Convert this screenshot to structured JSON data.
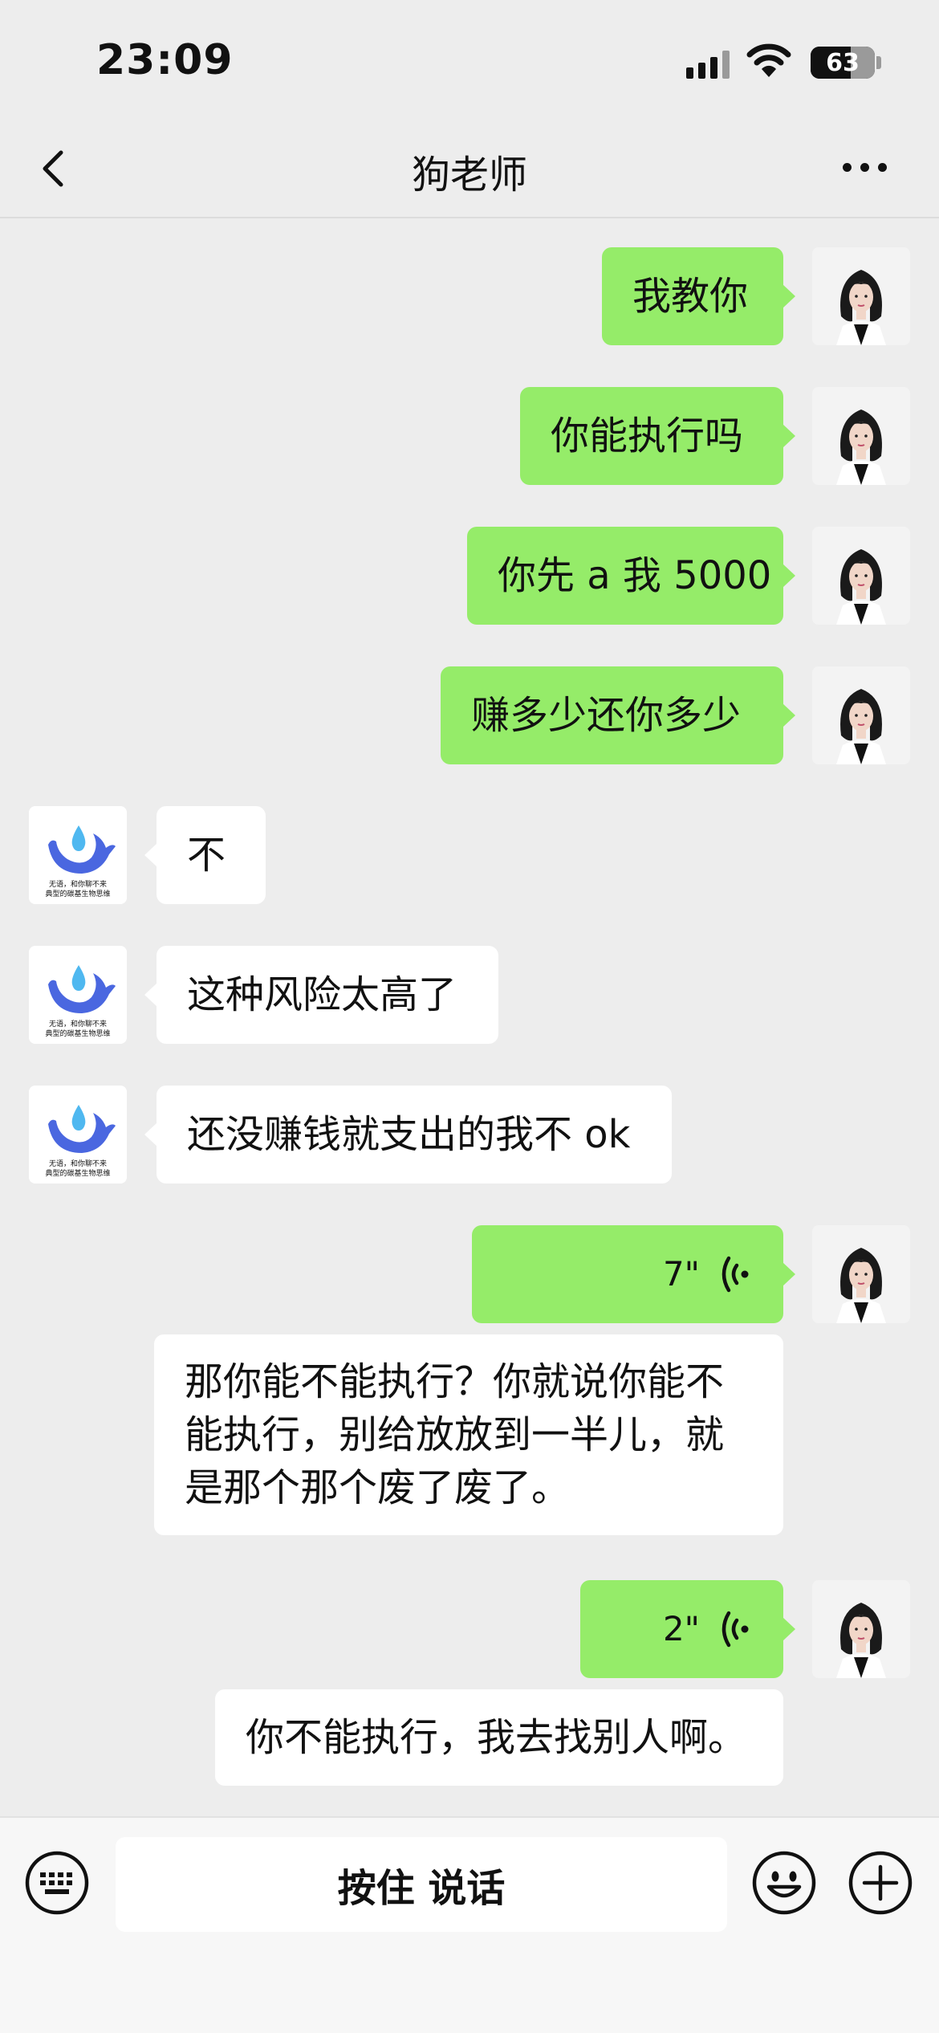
{
  "status_bar": {
    "time": "23:09",
    "battery": "63"
  },
  "nav": {
    "title": "狗老师"
  },
  "messages": [
    {
      "from": "me",
      "text": "我教你"
    },
    {
      "from": "me",
      "text": "你能执行吗"
    },
    {
      "from": "me",
      "text": "你先 a 我 5000"
    },
    {
      "from": "me",
      "text": "赚多少还你多少"
    },
    {
      "from": "bot",
      "text": "不"
    },
    {
      "from": "bot",
      "text": "这种风险太高了"
    },
    {
      "from": "bot",
      "text": "还没赚钱就支出的我不 ok"
    },
    {
      "from": "me",
      "type": "voice",
      "duration": "7\"",
      "transcript": [
        "那你能不能执行？你就说你能不",
        "能执行，别给放放到一半儿，就",
        "是那个那个废了废了。"
      ]
    },
    {
      "from": "me",
      "type": "voice",
      "duration": "2\"",
      "transcript": [
        "你不能执行，我去找别人啊。"
      ]
    }
  ],
  "bot_avatar": {
    "caption_line1": "无语，和你聊不来",
    "caption_line2": "典型的碳基生物思维"
  },
  "input_bar": {
    "hold_to_talk": "按住 说话"
  },
  "icons": {
    "back": "chevron-left-icon",
    "more": "ellipsis-icon",
    "keyboard": "keyboard-icon",
    "emoji": "smiley-icon",
    "plus": "plus-circle-icon",
    "voice": "voice-wave-icon"
  },
  "colors": {
    "my_bubble": "#95ec69",
    "bot_bubble": "#ffffff",
    "background": "#ededed",
    "whale": "#4a67e0"
  }
}
